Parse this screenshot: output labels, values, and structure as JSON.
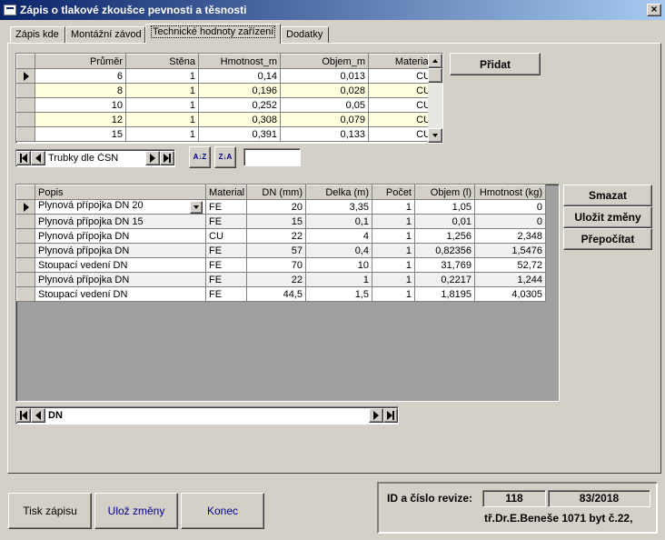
{
  "window": {
    "title": "Zápis o tlakové zkoušce pevnosti a těsnosti",
    "close": "×"
  },
  "tabs": [
    {
      "label": "Zápis kde"
    },
    {
      "label": "Montážní závod"
    },
    {
      "label": "Technické hodnoty zařízení"
    },
    {
      "label": "Dodatky"
    }
  ],
  "pipes_grid": {
    "headers": [
      "Průměr",
      "Stěna",
      "Hmotnost_m",
      "Objem_m",
      "Material"
    ],
    "rows": [
      [
        "6",
        "1",
        "0,14",
        "0,013",
        "CU"
      ],
      [
        "8",
        "1",
        "0,196",
        "0,028",
        "CU"
      ],
      [
        "10",
        "1",
        "0,252",
        "0,05",
        "CU"
      ],
      [
        "12",
        "1",
        "0,308",
        "0,079",
        "CU"
      ],
      [
        "15",
        "1",
        "0,391",
        "0,133",
        "CU"
      ]
    ]
  },
  "pipes_nav": {
    "label": "Trubky dle ČSN"
  },
  "add_button": {
    "label": "Přidat"
  },
  "sort": {
    "asc": "A↓Z",
    "desc": "Z↓A"
  },
  "items_grid": {
    "headers": [
      "Popis",
      "Material",
      "DN (mm)",
      "Delka (m)",
      "Počet",
      "Objem (l)",
      "Hmotnost (kg)"
    ],
    "rows": [
      [
        "Plynová přípojka DN 20",
        "FE",
        "20",
        "3,35",
        "1",
        "1,05",
        "0"
      ],
      [
        "Plynová přípojka DN 15",
        "FE",
        "15",
        "0,1",
        "1",
        "0,01",
        "0"
      ],
      [
        "Plynová přípojka DN",
        "CU",
        "22",
        "4",
        "1",
        "1,256",
        "2,348"
      ],
      [
        "Plynová přípojka DN",
        "FE",
        "57",
        "0,4",
        "1",
        "0,82356",
        "1,5476"
      ],
      [
        "Stoupací vedení DN",
        "FE",
        "70",
        "10",
        "1",
        "31,769",
        "52,72"
      ],
      [
        "Plynová přípojka DN",
        "FE",
        "22",
        "1",
        "1",
        "0,2217",
        "1,244"
      ],
      [
        "Stoupací vedení DN",
        "FE",
        "44,5",
        "1,5",
        "1",
        "1,8195",
        "4,0305"
      ]
    ]
  },
  "items_nav": {
    "label": "DN"
  },
  "side_buttons": {
    "delete": "Smazat",
    "save": "Uložit změny",
    "recalc": "Přepočítat"
  },
  "bottom_buttons": {
    "print": "Tisk zápisu",
    "save": "Ulož změny",
    "close": "Konec"
  },
  "revision": {
    "label": "ID a číslo revize:",
    "id": "118",
    "number": "83/2018",
    "address": "tř.Dr.E.Beneše 1071 byt č.22,"
  }
}
